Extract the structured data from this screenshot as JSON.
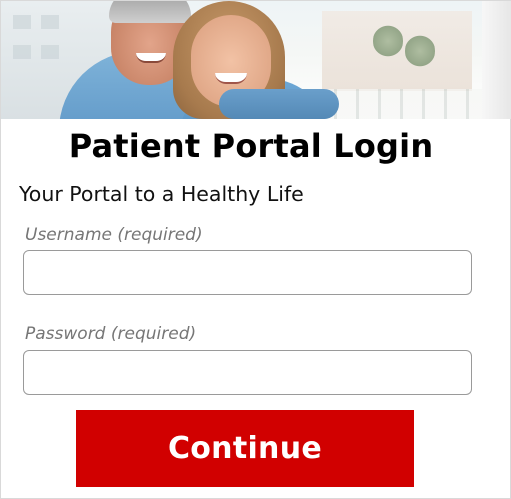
{
  "hero": {
    "image_description_icon": "couple-photo-icon"
  },
  "header": {
    "title": "Patient Portal Login",
    "subtitle": "Your Portal to a Healthy Life"
  },
  "form": {
    "username": {
      "label": "Username (required)",
      "value": "",
      "placeholder": ""
    },
    "password": {
      "label": "Password (required)",
      "value": "",
      "placeholder": ""
    },
    "continue_label": "Continue"
  },
  "colors": {
    "accent": "#d10000",
    "label_text": "#767676",
    "border": "#9a9a9a"
  }
}
